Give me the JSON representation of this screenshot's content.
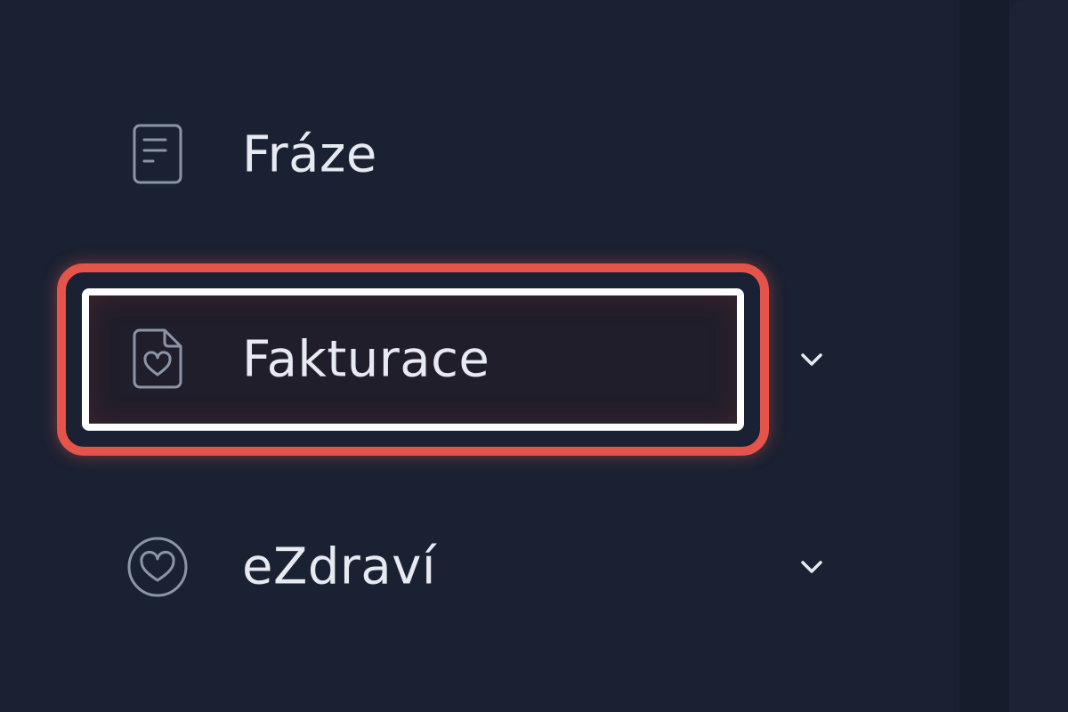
{
  "sidebar": {
    "items": [
      {
        "label": "Fráze",
        "icon": "document-lines-icon",
        "expandable": false
      },
      {
        "label": "Fakturace",
        "icon": "document-heart-icon",
        "expandable": true,
        "focused": true
      },
      {
        "label": "eZdraví",
        "icon": "heart-circle-icon",
        "expandable": true
      }
    ]
  },
  "colors": {
    "background": "#1a2132",
    "text": "#e7eaf1",
    "icon": "#8b95a7",
    "focus_inner": "#ffffff",
    "focus_outer": "#e4544a"
  }
}
